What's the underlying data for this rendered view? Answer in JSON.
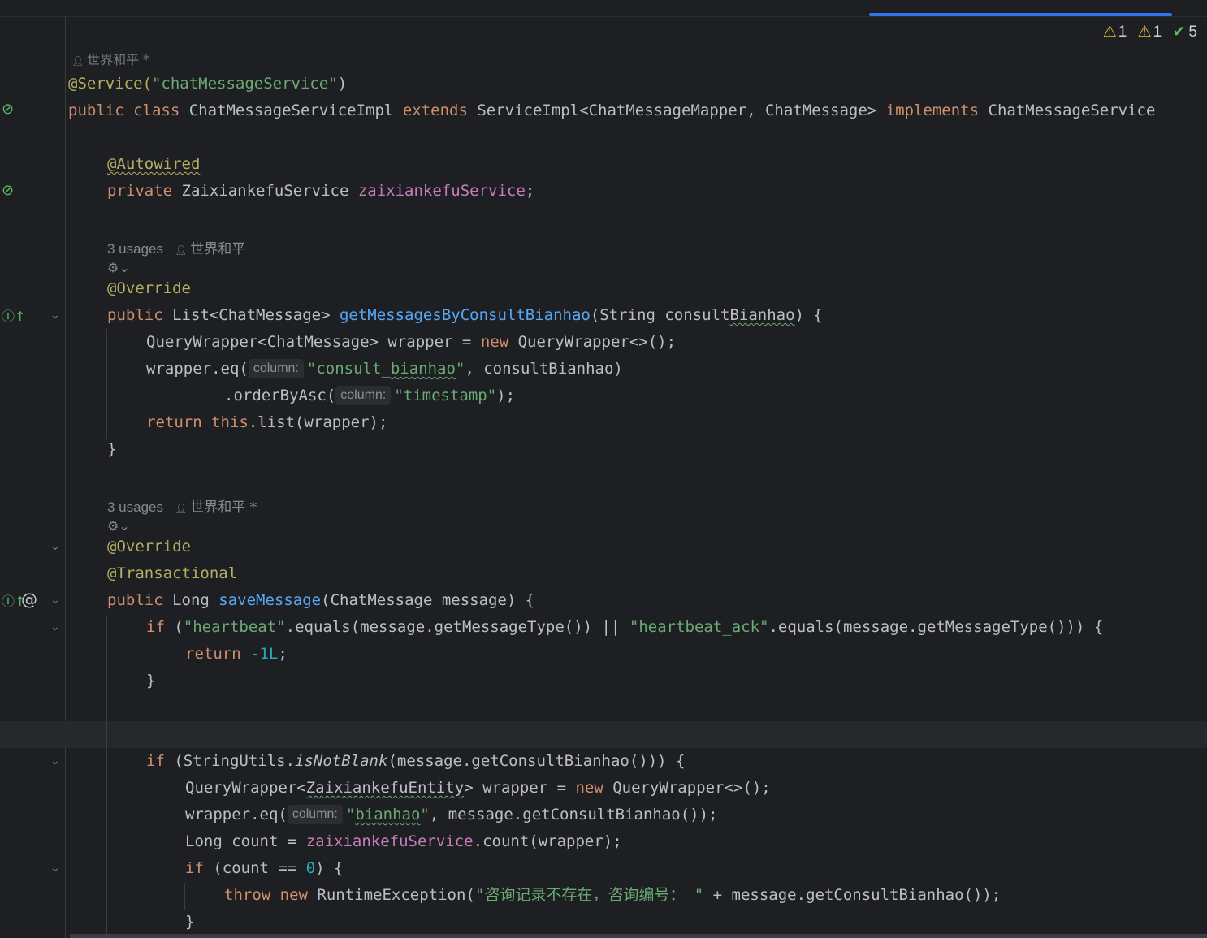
{
  "inspections": {
    "warnings_a": "1",
    "warnings_b": "1",
    "ok": "5"
  },
  "class_author": "世界和平 *",
  "method1_meta": {
    "usages": "3 usages",
    "author": "世界和平"
  },
  "method2_meta": {
    "usages": "3 usages",
    "author": "世界和平 *"
  },
  "hints": {
    "column": "column:"
  },
  "colors": {
    "keyword": "#cf8e6d",
    "annotation": "#b3ae60",
    "string": "#6aab73",
    "field": "#c77dbb",
    "method": "#56a8f5",
    "number": "#2aacb8",
    "accent": "#3574f0"
  },
  "icons": [
    "user-icon",
    "ai-assistant-icon",
    "bean-icon",
    "bean-injected-icon",
    "implementing-method-icon",
    "override-at-icon",
    "fold-chevron-icon",
    "warning-icon",
    "checkmark-icon"
  ],
  "code": {
    "l1": {
      "ann": "@Service(",
      "str": "\"chatMessageService\"",
      "close": ")"
    },
    "l2": {
      "kw1": "public class ",
      "cls": "ChatMessageServiceImpl ",
      "kw2": "extends ",
      "sup": "ServiceImpl<ChatMessageMapper, ChatMessage> ",
      "kw3": "implements ",
      "iface": "ChatMessageService"
    },
    "l4": {
      "ann": "@Autowired"
    },
    "l5": {
      "kw": "private ",
      "type": "ZaixiankefuService ",
      "fld": "zaixiankefuService",
      "end": ";"
    },
    "l8": {
      "ann": "@Override"
    },
    "l9": {
      "kw": "public ",
      "type": "List<ChatMessage> ",
      "fn": "getMessagesByConsultBianhao",
      "p1": "(String consult",
      "p2": "Bianhao",
      "p3": ") {"
    },
    "l10": {
      "a": "QueryWrapper<ChatMessage> wrapper = ",
      "kw": "new ",
      "b": "QueryWrapper<>();"
    },
    "l11": {
      "a": "wrapper.eq(",
      "s1": "\"consult_",
      "s2": "bianhao",
      "s3": "\"",
      "b": ", consultBianhao)"
    },
    "l12": {
      "a": ".orderByAsc(",
      "str": "\"timestamp\"",
      "b": ");"
    },
    "l13": {
      "kw": "return ",
      "kw2": "this",
      "b": ".list(wrapper);"
    },
    "l14": {
      "b": "}"
    },
    "l17": {
      "ann": "@Override"
    },
    "l18": {
      "ann": "@Transactional"
    },
    "l19": {
      "kw": "public ",
      "type": "Long ",
      "fn": "saveMessage",
      "b": "(ChatMessage message) {"
    },
    "l20": {
      "kw": "if ",
      "a": "(",
      "s1": "\"heartbeat\"",
      "b": ".equals(message.getMessageType()) || ",
      "s2": "\"heartbeat_ack\"",
      "c": ".equals(message.getMessageType())) {"
    },
    "l21": {
      "kw": "return ",
      "num": "-1L",
      "b": ";"
    },
    "l22": {
      "b": "}"
    },
    "l24": {
      "kw": "if ",
      "a": "(StringUtils.",
      "it": "isNotBlank",
      "b": "(message.getConsultBianhao())) {"
    },
    "l25": {
      "a": "QueryWrapper<",
      "w": "ZaixiankefuEntity",
      "b": "> wrapper = ",
      "kw": "new ",
      "c": "QueryWrapper<>();"
    },
    "l26": {
      "a": "wrapper.eq(",
      "s1": "\"",
      "s2": "bianhao",
      "s3": "\"",
      "b": ", message.getConsultBianhao());"
    },
    "l27": {
      "a": "Long count = ",
      "fld": "zaixiankefuService",
      "b": ".count(wrapper);"
    },
    "l28": {
      "kw": "if ",
      "a": "(count == ",
      "num": "0",
      "b": ") {"
    },
    "l29": {
      "kw1": "throw ",
      "kw2": "new ",
      "a": "RuntimeException(",
      "s1": "\"",
      "s_cjk": "咨询记录不存在，咨询编号：",
      "s2": " \"",
      "b": " + message.getConsultBianhao());"
    },
    "l30": {
      "b": "}"
    }
  }
}
